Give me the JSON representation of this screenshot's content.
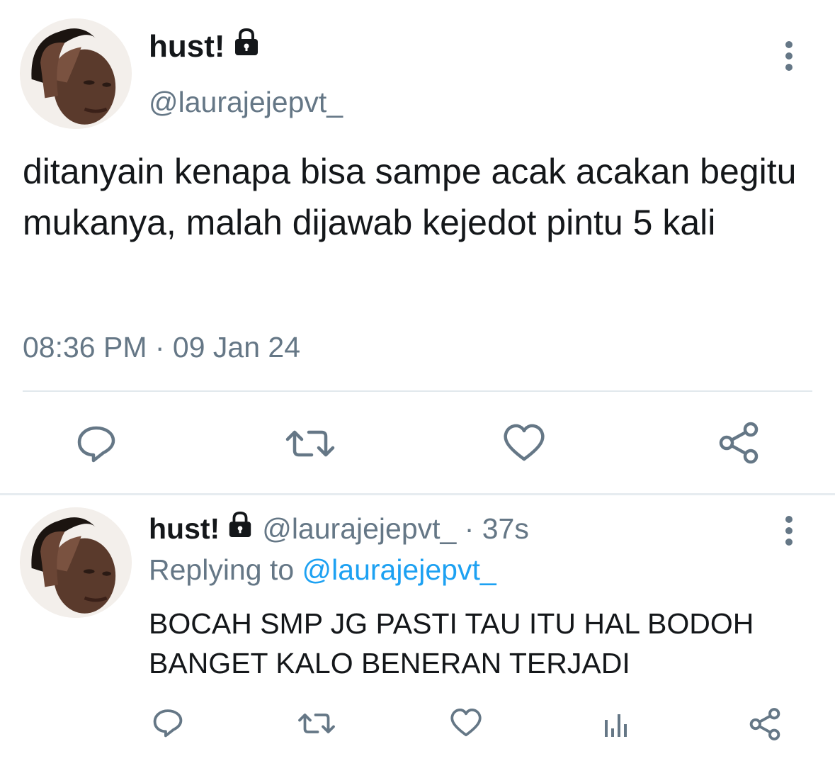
{
  "main_tweet": {
    "display_name": "hust!",
    "handle": "@laurajejepvt_",
    "text": "ditanyain kenapa bisa sampe acak acakan begitu mukanya, malah dijawab kejedot pintu 5 kali",
    "timestamp": "08:36 PM · 09 Jan 24",
    "actions": [
      "reply-icon",
      "retweet-icon",
      "like-icon",
      "share-icon"
    ]
  },
  "reply_tweet": {
    "display_name": "hust!",
    "handle_time": "@laurajejepvt_ · 37s",
    "replying_prefix": "Replying to",
    "replying_to": "@laurajejepvt_",
    "text": "BOCAH SMP JG PASTI TAU ITU HAL BODOH BANGET KALO BENERAN TERJADI",
    "actions": [
      "reply-icon",
      "retweet-icon",
      "like-icon",
      "analytics-icon",
      "share-icon"
    ]
  },
  "colors": {
    "text": "#14171a",
    "secondary": "#657786",
    "link": "#1da1f2",
    "divider": "#e1e8ed"
  }
}
